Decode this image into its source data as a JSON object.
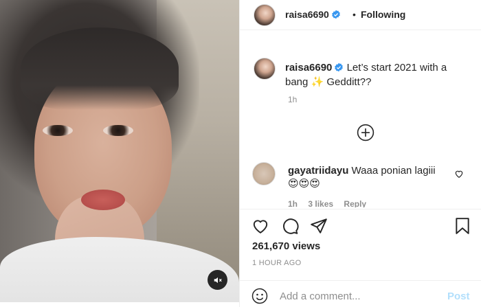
{
  "post": {
    "username": "raisa6690",
    "verified_icon": "verified-badge-icon",
    "follow_separator": "•",
    "follow_status": "Following"
  },
  "caption": {
    "username": "raisa6690",
    "text": "Let’s start 2021 with a bang ✨ Gedditt??",
    "time": "1h"
  },
  "comments": [
    {
      "username": "gayatriidayu",
      "text": "Waaa ponian lagiii",
      "emojis": "😍😍😍",
      "time": "1h",
      "likes": "3 likes",
      "reply_label": "Reply"
    }
  ],
  "stats": {
    "views": "261,670 views",
    "posted": "1 HOUR AGO"
  },
  "add_comment": {
    "placeholder": "Add a comment...",
    "post_label": "Post"
  },
  "colors": {
    "verified": "#3897f0",
    "post_button_disabled": "#b2dffc",
    "secondary_text": "#8e8e8e"
  },
  "icons": {
    "mute": "speaker-muted-icon",
    "add_more": "plus-circle-icon",
    "like": "heart-icon",
    "comment": "comment-bubble-icon",
    "share": "paper-plane-icon",
    "save": "bookmark-icon",
    "emoji": "smiley-icon"
  }
}
